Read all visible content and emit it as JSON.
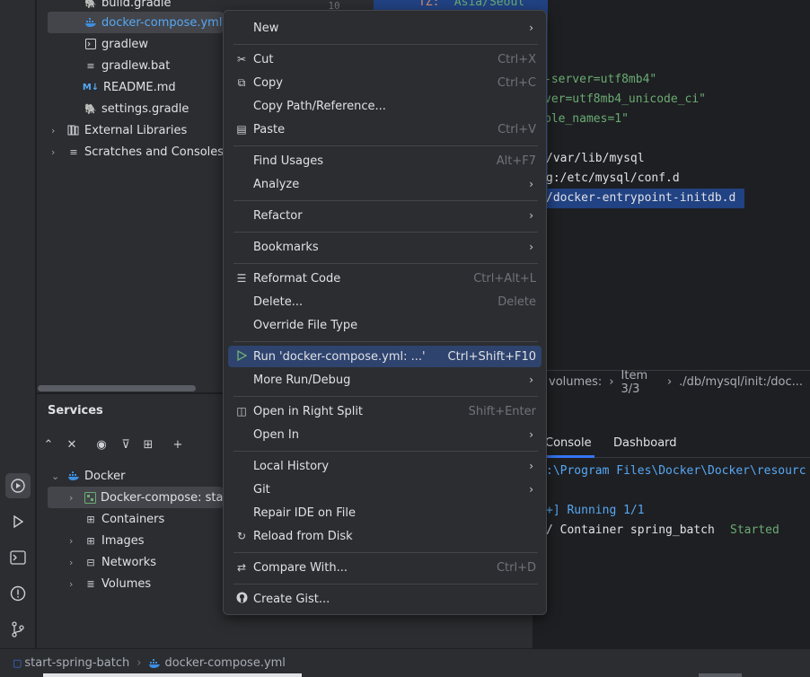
{
  "project_tree": {
    "items": [
      {
        "label": "build.gradle",
        "icon": "gradle-icon"
      },
      {
        "label": "docker-compose.yml",
        "icon": "docker-icon"
      },
      {
        "label": "gradlew",
        "icon": "terminal-file-icon"
      },
      {
        "label": "gradlew.bat",
        "icon": "text-file-icon"
      },
      {
        "label": "README.md",
        "icon": "markdown-icon",
        "prefix": "M↓"
      },
      {
        "label": "settings.gradle",
        "icon": "gradle-icon"
      },
      {
        "label": "External Libraries",
        "icon": "library-icon"
      },
      {
        "label": "Scratches and Consoles",
        "icon": "scratches-icon"
      }
    ],
    "line_number": "10"
  },
  "editor": {
    "lines": [
      {
        "key": "TZ: ",
        "value": "\"Asia/Seoul\""
      },
      {
        "value": "-server=utf8mb4\""
      },
      {
        "value": "ver=utf8mb4_unicode_ci\""
      },
      {
        "value": "ble_names=1\""
      },
      {
        "value": "/var/lib/mysql"
      },
      {
        "value": "g:/etc/mysql/conf.d"
      },
      {
        "value": "/docker-entrypoint-initdb.d"
      }
    ],
    "breadcrumb": [
      "volumes:",
      "Item 3/3",
      "./db/mysql/init:/doc..."
    ]
  },
  "services": {
    "title": "Services",
    "tree": [
      {
        "label": "Docker"
      },
      {
        "label": "Docker-compose: star"
      },
      {
        "label": "Containers"
      },
      {
        "label": "Images"
      },
      {
        "label": "Networks"
      },
      {
        "label": "Volumes"
      }
    ]
  },
  "console": {
    "tabs": [
      "Console",
      "Dashboard"
    ],
    "lines": [
      ":\\Program Files\\Docker\\Docker\\resourc",
      "+] Running 1/1",
      "/ Container spring_batch",
      "Started"
    ]
  },
  "context_menu": {
    "items": [
      {
        "label": "New",
        "submenu": true
      },
      {
        "label": "Cut",
        "shortcut": "Ctrl+X",
        "icon": "scissors-icon"
      },
      {
        "label": "Copy",
        "shortcut": "Ctrl+C",
        "icon": "copy-icon"
      },
      {
        "label": "Copy Path/Reference..."
      },
      {
        "label": "Paste",
        "shortcut": "Ctrl+V",
        "icon": "paste-icon"
      },
      {
        "label": "Find Usages",
        "shortcut": "Alt+F7"
      },
      {
        "label": "Analyze",
        "submenu": true
      },
      {
        "label": "Refactor",
        "submenu": true
      },
      {
        "label": "Bookmarks",
        "submenu": true
      },
      {
        "label": "Reformat Code",
        "shortcut": "Ctrl+Alt+L",
        "icon": "reformat-icon"
      },
      {
        "label": "Delete...",
        "shortcut": "Delete"
      },
      {
        "label": "Override File Type"
      },
      {
        "label": "Run 'docker-compose.yml: ...'",
        "shortcut": "Ctrl+Shift+F10",
        "icon": "run-icon",
        "highlighted": true
      },
      {
        "label": "More Run/Debug",
        "submenu": true
      },
      {
        "label": "Open in Right Split",
        "shortcut": "Shift+Enter",
        "icon": "split-icon"
      },
      {
        "label": "Open In",
        "submenu": true
      },
      {
        "label": "Local History",
        "submenu": true
      },
      {
        "label": "Git",
        "submenu": true
      },
      {
        "label": "Repair IDE on File"
      },
      {
        "label": "Reload from Disk",
        "icon": "reload-icon"
      },
      {
        "label": "Compare With...",
        "shortcut": "Ctrl+D",
        "icon": "compare-icon"
      },
      {
        "label": "Create Gist...",
        "icon": "github-icon"
      }
    ]
  },
  "statusbar": {
    "project": "start-spring-batch",
    "file": "docker-compose.yml"
  },
  "colors": {
    "accent": "#3574f0",
    "selection": "#214283",
    "menu_highlight": "#2e436e",
    "string": "#6aab73",
    "console_path": "#56a8f5",
    "started": "#6aab73"
  }
}
